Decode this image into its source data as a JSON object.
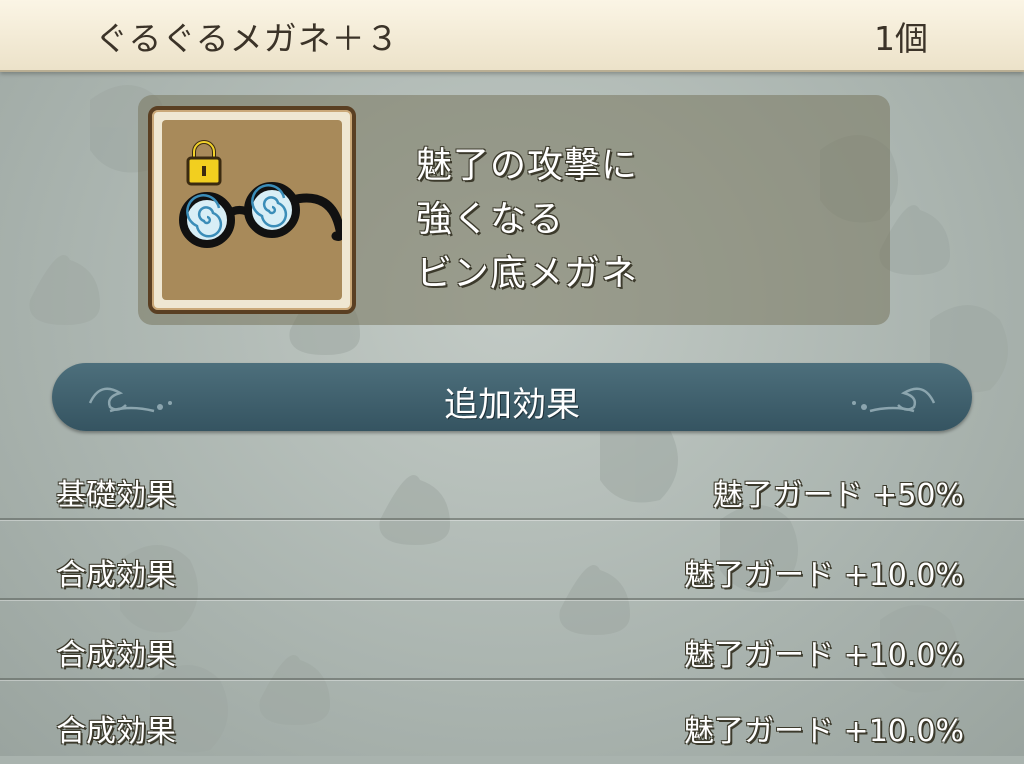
{
  "header": {
    "item_name": "ぐるぐるメガネ＋３",
    "count": "1個"
  },
  "item": {
    "icon": "swirl-glasses-icon",
    "lock_icon": "padlock-icon",
    "description": [
      "魅了の攻撃に",
      "強くなる",
      "ビン底メガネ"
    ]
  },
  "section": {
    "title": "追加効果"
  },
  "effects": [
    {
      "label": "基礎効果",
      "value": "魅了ガード +50%"
    },
    {
      "label": "合成効果",
      "value": "魅了ガード +10.0%"
    },
    {
      "label": "合成効果",
      "value": "魅了ガード +10.0%"
    },
    {
      "label": "合成効果",
      "value": "魅了ガード +10.0%"
    }
  ],
  "colors": {
    "title_bar": "#f4ecd8",
    "banner": "#3f606d",
    "background": "#aab4af"
  }
}
